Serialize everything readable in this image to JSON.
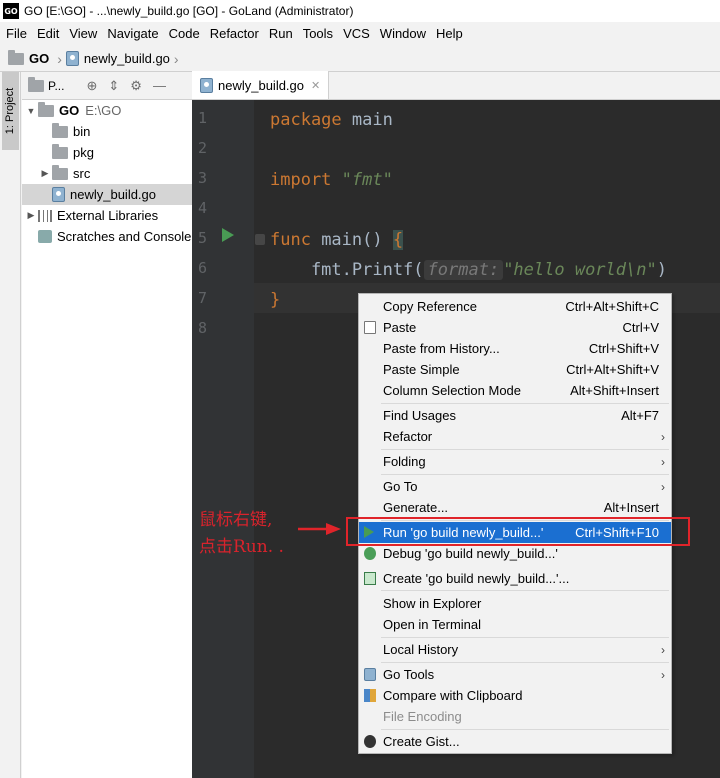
{
  "window": {
    "app_icon_text": "GO",
    "title": "GO [E:\\GO] - ...\\newly_build.go [GO] - GoLand (Administrator)"
  },
  "menu": [
    "File",
    "Edit",
    "View",
    "Navigate",
    "Code",
    "Refactor",
    "Run",
    "Tools",
    "VCS",
    "Window",
    "Help"
  ],
  "breadcrumb": {
    "root": "GO",
    "file": "newly_build.go"
  },
  "side_tab": "1: Project",
  "project_panel": {
    "title": "P...",
    "tree": [
      {
        "label": "GO",
        "path": "E:\\GO"
      },
      {
        "label": "bin"
      },
      {
        "label": "pkg"
      },
      {
        "label": "src"
      },
      {
        "label": "newly_build.go"
      },
      {
        "label": "External Libraries"
      },
      {
        "label": "Scratches and Console"
      }
    ]
  },
  "editor": {
    "tab_label": "newly_build.go",
    "line_numbers": [
      "1",
      "2",
      "3",
      "4",
      "5",
      "6",
      "7",
      "8"
    ],
    "code": {
      "l1_kw": "package",
      "l1_rest": " main",
      "l3_kw": "import",
      "l3_str": "\"fmt\"",
      "l5_kw": "func",
      "l5_name": " main() ",
      "l5_brace": "{",
      "l6_pre": "    fmt.Printf(",
      "l6_hint": "format:",
      "l6_str": "\"hello world\\n\"",
      "l6_post": ")",
      "l7": "}"
    }
  },
  "context_menu": {
    "items": [
      {
        "label": "Copy Reference",
        "shortcut": "Ctrl+Alt+Shift+C"
      },
      {
        "label": "Paste",
        "shortcut": "Ctrl+V",
        "icon": "paste-icon"
      },
      {
        "label": "Paste from History...",
        "shortcut": "Ctrl+Shift+V"
      },
      {
        "label": "Paste Simple",
        "shortcut": "Ctrl+Alt+Shift+V"
      },
      {
        "label": "Column Selection Mode",
        "shortcut": "Alt+Shift+Insert"
      },
      {
        "label": "Find Usages",
        "shortcut": "Alt+F7"
      },
      {
        "label": "Refactor",
        "submenu": true
      },
      {
        "label": "Folding",
        "submenu": true
      },
      {
        "label": "Go To",
        "submenu": true
      },
      {
        "label": "Generate...",
        "shortcut": "Alt+Insert"
      },
      {
        "label": "Run 'go build newly_build...'",
        "shortcut": "Ctrl+Shift+F10",
        "icon": "run-icon",
        "highlighted": true
      },
      {
        "label": "Debug 'go build newly_build...'",
        "icon": "debug-icon"
      },
      {
        "label": "Create 'go build newly_build...'...",
        "icon": "create-config-icon"
      },
      {
        "label": "Show in Explorer"
      },
      {
        "label": "Open in Terminal"
      },
      {
        "label": "Local History",
        "submenu": true
      },
      {
        "label": "Go Tools",
        "submenu": true,
        "icon": "go-tools-icon"
      },
      {
        "label": "Compare with Clipboard",
        "icon": "compare-icon"
      },
      {
        "label": "File Encoding",
        "disabled": true
      },
      {
        "label": "Create Gist..."
      }
    ]
  },
  "annotation": {
    "line1": "鼠标右键,",
    "line2": "点击Run. .",
    "color": "#d9232c"
  },
  "colors": {
    "editor_bg": "#2b2b2b",
    "keyword": "#cc7832",
    "string": "#6a8759",
    "menu_highlight": "#1b6fd1"
  }
}
